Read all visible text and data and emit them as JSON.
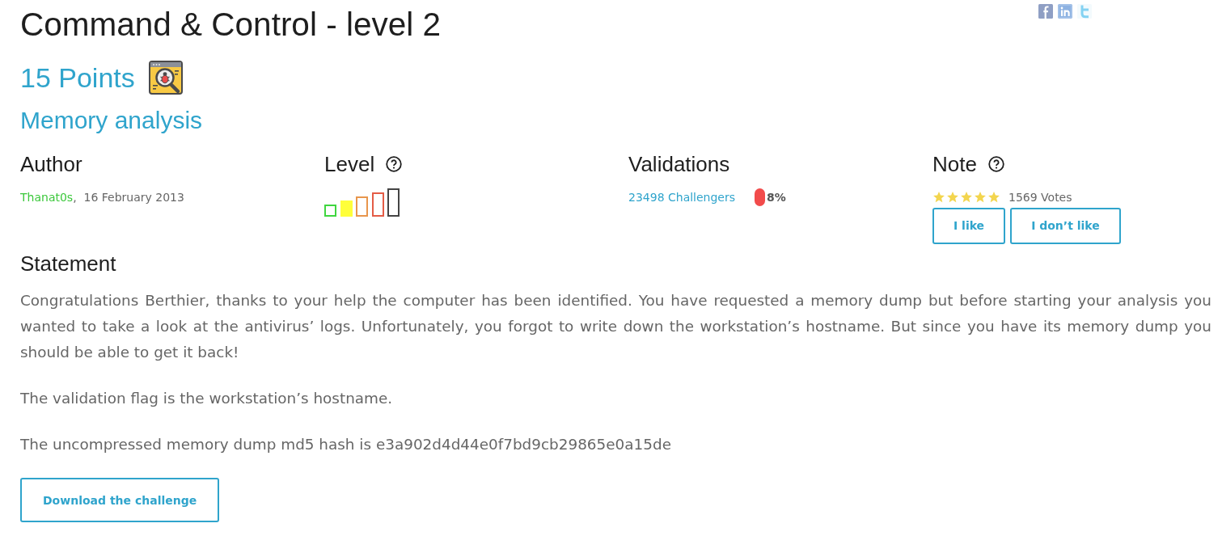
{
  "title": "Command & Control - level 2",
  "share_links": [
    {
      "kind": "facebook"
    },
    {
      "kind": "linkedin"
    },
    {
      "kind": "twitter"
    }
  ],
  "points": "15 Points",
  "category": "Memory analysis",
  "author": {
    "heading": "Author",
    "name": "Thanat0s",
    "date": ",  16 February 2013"
  },
  "level": {
    "heading": "Level",
    "bars": [
      {
        "color": "#3fd63f",
        "selected": false
      },
      {
        "color": "#ffff3a",
        "selected": true
      },
      {
        "color": "#e8964c",
        "selected": false
      },
      {
        "color": "#e45c46",
        "selected": false
      },
      {
        "color": "#444444",
        "selected": false
      }
    ]
  },
  "validations": {
    "heading": "Validations",
    "challengers": "23498 Challengers",
    "rate": "8%"
  },
  "note": {
    "heading": "Note",
    "stars": 5,
    "votes": "1569 Votes",
    "buttons": [
      "I like",
      "I don’t like"
    ]
  },
  "statement": {
    "heading": "Statement",
    "paragraphs": [
      "Congratulations Berthier, thanks to your help the computer has been identified. You have requested a memory dump but before starting your analysis you wanted to take a look at the antivirus’ logs. Unfortunately, you forgot to write down the workstation’s hostname. But since you have its memory dump you should be able to get it back!",
      "The validation flag is the workstation’s hostname.",
      "The uncompressed memory dump md5 hash is e3a902d4d44e0f7bd9cb29865e0a15de"
    ]
  },
  "download_button": "Download the challenge"
}
